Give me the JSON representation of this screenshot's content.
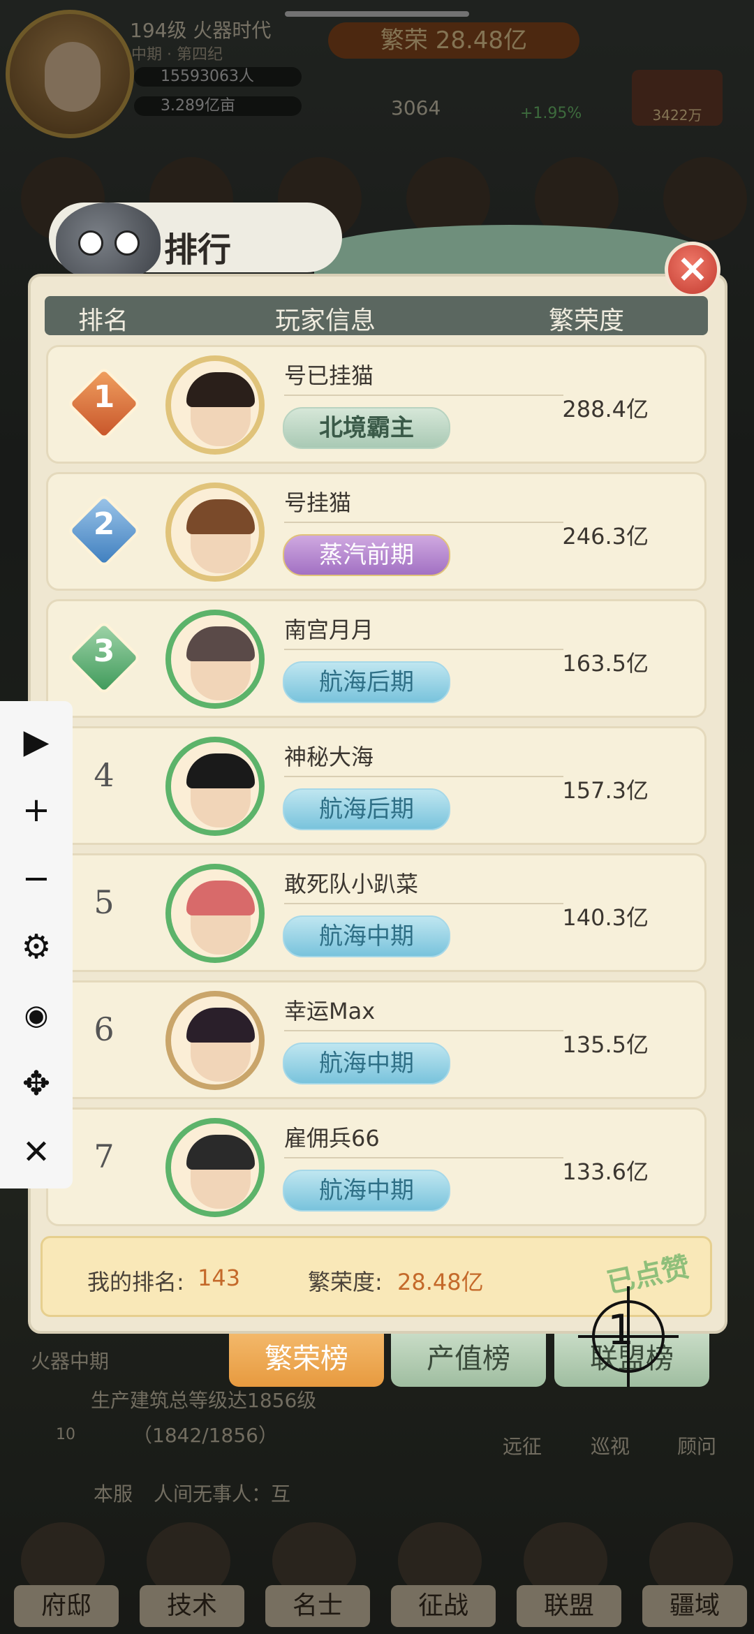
{
  "hud": {
    "level_age": "194级 火器时代",
    "period": "中期 · 第四纪",
    "population": "15593063人",
    "land": "3.289亿亩",
    "prosperity": "繁荣 28.48亿",
    "gems": "3064",
    "growth": "+1.95%",
    "gold": "3422万"
  },
  "panel": {
    "title": "排行",
    "close_icon": "close-icon",
    "header": {
      "rank": "排名",
      "player": "玩家信息",
      "prosperity": "繁荣度"
    }
  },
  "rows": [
    {
      "rank": "1",
      "name": "号已挂猫",
      "era": "北境霸主",
      "era_style": "green",
      "value": "288.4亿"
    },
    {
      "rank": "2",
      "name": "号挂猫",
      "era": "蒸汽前期",
      "era_style": "purple",
      "value": "246.3亿"
    },
    {
      "rank": "3",
      "name": "南宫月月",
      "era": "航海后期",
      "era_style": "blue",
      "value": "163.5亿"
    },
    {
      "rank": "4",
      "name": "神秘大海",
      "era": "航海后期",
      "era_style": "blue",
      "value": "157.3亿"
    },
    {
      "rank": "5",
      "name": "敢死队小趴菜",
      "era": "航海中期",
      "era_style": "blue",
      "value": "140.3亿"
    },
    {
      "rank": "6",
      "name": "幸运Max",
      "era": "航海中期",
      "era_style": "blue",
      "value": "135.5亿"
    },
    {
      "rank": "7",
      "name": "雇佣兵66",
      "era": "航海中期",
      "era_style": "blue",
      "value": "133.6亿"
    }
  ],
  "footer": {
    "my_rank_label": "我的排名:",
    "my_rank": "143",
    "my_prosperity_label": "繁荣度:",
    "my_prosperity": "28.48亿",
    "liked": "已点赞"
  },
  "tabs": [
    "繁荣榜",
    "产值榜",
    "联盟榜"
  ],
  "cursor_label": "1",
  "float_toolbar": [
    "play-icon",
    "plus-icon",
    "minus-icon",
    "gear-icon",
    "eye-off-icon",
    "move-icon",
    "close-icon"
  ],
  "background": {
    "era_tag": "火器中期",
    "task": "生产建筑总等级达1856级",
    "task_progress": "（1842/1856）",
    "task_count": "10",
    "chat_channel": "本服",
    "chat_text": "人间无事人：互",
    "side_labels": [
      "远征",
      "巡视",
      "顾问"
    ]
  },
  "bottom_nav": [
    "府邸",
    "技术",
    "名士",
    "征战",
    "联盟",
    "疆域"
  ]
}
